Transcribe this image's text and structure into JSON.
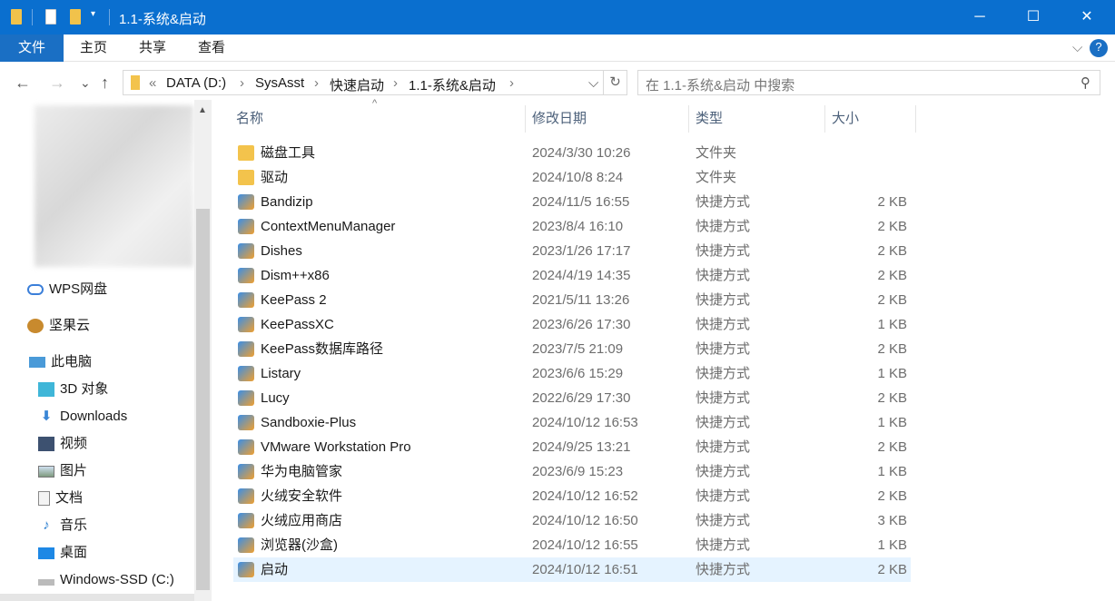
{
  "window": {
    "title": "1.1-系统&启动",
    "minimize": "─",
    "maximize": "☐",
    "close": "✕"
  },
  "ribbon": {
    "tabs": [
      "文件",
      "主页",
      "共享",
      "查看"
    ],
    "expand": "⌵",
    "help": "?"
  },
  "nav": {
    "back": "←",
    "forward": "→",
    "recent": "⌄",
    "up": "↑",
    "prefix": "«",
    "breadcrumb": [
      "DATA (D:)",
      "SysAsst",
      "快速启动",
      "1.1-系统&启动"
    ],
    "sep": "›",
    "dropdown": "⌵",
    "refresh": "↻",
    "search_placeholder": "在 1.1-系统&启动 中搜索",
    "search_icon": "⚲"
  },
  "sidebar": {
    "items": [
      {
        "label": "WPS网盘",
        "icon": "cloud-icon"
      },
      {
        "label": "坚果云",
        "icon": "nut-icon"
      },
      {
        "label": "此电脑",
        "icon": "computer-icon"
      },
      {
        "label": "3D 对象",
        "icon": "cube-icon"
      },
      {
        "label": "Downloads",
        "icon": "download-icon"
      },
      {
        "label": "视频",
        "icon": "video-icon"
      },
      {
        "label": "图片",
        "icon": "picture-icon"
      },
      {
        "label": "文档",
        "icon": "document-icon"
      },
      {
        "label": "音乐",
        "icon": "music-icon"
      },
      {
        "label": "桌面",
        "icon": "desktop-icon"
      },
      {
        "label": "Windows-SSD (C:)",
        "icon": "drive-icon"
      }
    ]
  },
  "columns": {
    "name": "名称",
    "date": "修改日期",
    "type": "类型",
    "size": "大小",
    "sort_arrow": "^"
  },
  "files": [
    {
      "name": "磁盘工具",
      "date": "2024/3/30 10:26",
      "type": "文件夹",
      "size": ""
    },
    {
      "name": "驱动",
      "date": "2024/10/8 8:24",
      "type": "文件夹",
      "size": ""
    },
    {
      "name": "Bandizip",
      "date": "2024/11/5 16:55",
      "type": "快捷方式",
      "size": "2 KB"
    },
    {
      "name": "ContextMenuManager",
      "date": "2023/8/4 16:10",
      "type": "快捷方式",
      "size": "2 KB"
    },
    {
      "name": "Dishes",
      "date": "2023/1/26 17:17",
      "type": "快捷方式",
      "size": "2 KB"
    },
    {
      "name": "Dism++x86",
      "date": "2024/4/19 14:35",
      "type": "快捷方式",
      "size": "2 KB"
    },
    {
      "name": "KeePass 2",
      "date": "2021/5/11 13:26",
      "type": "快捷方式",
      "size": "2 KB"
    },
    {
      "name": "KeePassXC",
      "date": "2023/6/26 17:30",
      "type": "快捷方式",
      "size": "1 KB"
    },
    {
      "name": "KeePass数据库路径",
      "date": "2023/7/5 21:09",
      "type": "快捷方式",
      "size": "2 KB"
    },
    {
      "name": "Listary",
      "date": "2023/6/6 15:29",
      "type": "快捷方式",
      "size": "1 KB"
    },
    {
      "name": "Lucy",
      "date": "2022/6/29 17:30",
      "type": "快捷方式",
      "size": "2 KB"
    },
    {
      "name": "Sandboxie-Plus",
      "date": "2024/10/12 16:53",
      "type": "快捷方式",
      "size": "1 KB"
    },
    {
      "name": "VMware Workstation Pro",
      "date": "2024/9/25 13:21",
      "type": "快捷方式",
      "size": "2 KB"
    },
    {
      "name": "华为电脑管家",
      "date": "2023/6/9 15:23",
      "type": "快捷方式",
      "size": "1 KB"
    },
    {
      "name": "火绒安全软件",
      "date": "2024/10/12 16:52",
      "type": "快捷方式",
      "size": "2 KB"
    },
    {
      "name": "火绒应用商店",
      "date": "2024/10/12 16:50",
      "type": "快捷方式",
      "size": "3 KB"
    },
    {
      "name": "浏览器(沙盒)",
      "date": "2024/10/12 16:55",
      "type": "快捷方式",
      "size": "1 KB"
    },
    {
      "name": "启动",
      "date": "2024/10/12 16:51",
      "type": "快捷方式",
      "size": "2 KB",
      "selected": true
    }
  ],
  "colors": {
    "titlebar": "#0a6fcf",
    "selection": "#e5f3ff"
  }
}
